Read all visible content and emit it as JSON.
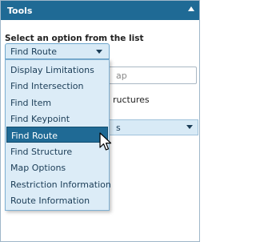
{
  "panel": {
    "title": "Tools"
  },
  "prompt": "Select an option from the list",
  "select": {
    "value": "Find Route"
  },
  "options": [
    "Display Limitations",
    "Find Intersection",
    "Find Item",
    "Find Keypoint",
    "Find Route",
    "Find Structure",
    "Map Options",
    "Restriction Information",
    "Route Information"
  ],
  "selected_index": 4,
  "background": {
    "input_partial": "ap",
    "checkbox_partial": "ructures",
    "accordion_partial": "s"
  }
}
